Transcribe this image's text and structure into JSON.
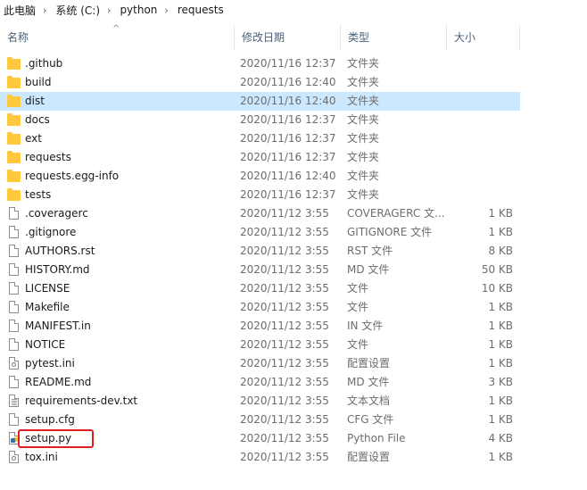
{
  "breadcrumb": [
    "此电脑",
    "系统 (C:)",
    "python",
    "requests"
  ],
  "columns": {
    "name": "名称",
    "date": "修改日期",
    "type": "类型",
    "size": "大小"
  },
  "sort_indicator": "^",
  "selected_index": 2,
  "highlighted_index": 20,
  "colors": {
    "folder": "#ffc83d",
    "selected": "#cce8ff",
    "highlight": "#e02020",
    "header_text": "#4c607a"
  },
  "files": [
    {
      "name": ".github",
      "date": "2020/11/16 12:37",
      "type": "文件夹",
      "size": "",
      "icon": "folder-icon"
    },
    {
      "name": "build",
      "date": "2020/11/16 12:40",
      "type": "文件夹",
      "size": "",
      "icon": "folder-icon"
    },
    {
      "name": "dist",
      "date": "2020/11/16 12:40",
      "type": "文件夹",
      "size": "",
      "icon": "folder-icon"
    },
    {
      "name": "docs",
      "date": "2020/11/16 12:37",
      "type": "文件夹",
      "size": "",
      "icon": "folder-icon"
    },
    {
      "name": "ext",
      "date": "2020/11/16 12:37",
      "type": "文件夹",
      "size": "",
      "icon": "folder-icon"
    },
    {
      "name": "requests",
      "date": "2020/11/16 12:37",
      "type": "文件夹",
      "size": "",
      "icon": "folder-icon"
    },
    {
      "name": "requests.egg-info",
      "date": "2020/11/16 12:40",
      "type": "文件夹",
      "size": "",
      "icon": "folder-icon"
    },
    {
      "name": "tests",
      "date": "2020/11/16 12:37",
      "type": "文件夹",
      "size": "",
      "icon": "folder-icon"
    },
    {
      "name": ".coveragerc",
      "date": "2020/11/12 3:55",
      "type": "COVERAGERC 文...",
      "size": "1 KB",
      "icon": "file-icon"
    },
    {
      "name": ".gitignore",
      "date": "2020/11/12 3:55",
      "type": "GITIGNORE 文件",
      "size": "1 KB",
      "icon": "file-icon"
    },
    {
      "name": "AUTHORS.rst",
      "date": "2020/11/12 3:55",
      "type": "RST 文件",
      "size": "8 KB",
      "icon": "file-icon"
    },
    {
      "name": "HISTORY.md",
      "date": "2020/11/12 3:55",
      "type": "MD 文件",
      "size": "50 KB",
      "icon": "file-icon"
    },
    {
      "name": "LICENSE",
      "date": "2020/11/12 3:55",
      "type": "文件",
      "size": "10 KB",
      "icon": "file-icon"
    },
    {
      "name": "Makefile",
      "date": "2020/11/12 3:55",
      "type": "文件",
      "size": "1 KB",
      "icon": "file-icon"
    },
    {
      "name": "MANIFEST.in",
      "date": "2020/11/12 3:55",
      "type": "IN 文件",
      "size": "1 KB",
      "icon": "file-icon"
    },
    {
      "name": "NOTICE",
      "date": "2020/11/12 3:55",
      "type": "文件",
      "size": "1 KB",
      "icon": "file-icon"
    },
    {
      "name": "pytest.ini",
      "date": "2020/11/12 3:55",
      "type": "配置设置",
      "size": "1 KB",
      "icon": "config-file-icon"
    },
    {
      "name": "README.md",
      "date": "2020/11/12 3:55",
      "type": "MD 文件",
      "size": "3 KB",
      "icon": "file-icon"
    },
    {
      "name": "requirements-dev.txt",
      "date": "2020/11/12 3:55",
      "type": "文本文档",
      "size": "1 KB",
      "icon": "text-file-icon"
    },
    {
      "name": "setup.cfg",
      "date": "2020/11/12 3:55",
      "type": "CFG 文件",
      "size": "1 KB",
      "icon": "file-icon"
    },
    {
      "name": "setup.py",
      "date": "2020/11/12 3:55",
      "type": "Python File",
      "size": "4 KB",
      "icon": "python-file-icon"
    },
    {
      "name": "tox.ini",
      "date": "2020/11/12 3:55",
      "type": "配置设置",
      "size": "1 KB",
      "icon": "config-file-icon"
    }
  ]
}
